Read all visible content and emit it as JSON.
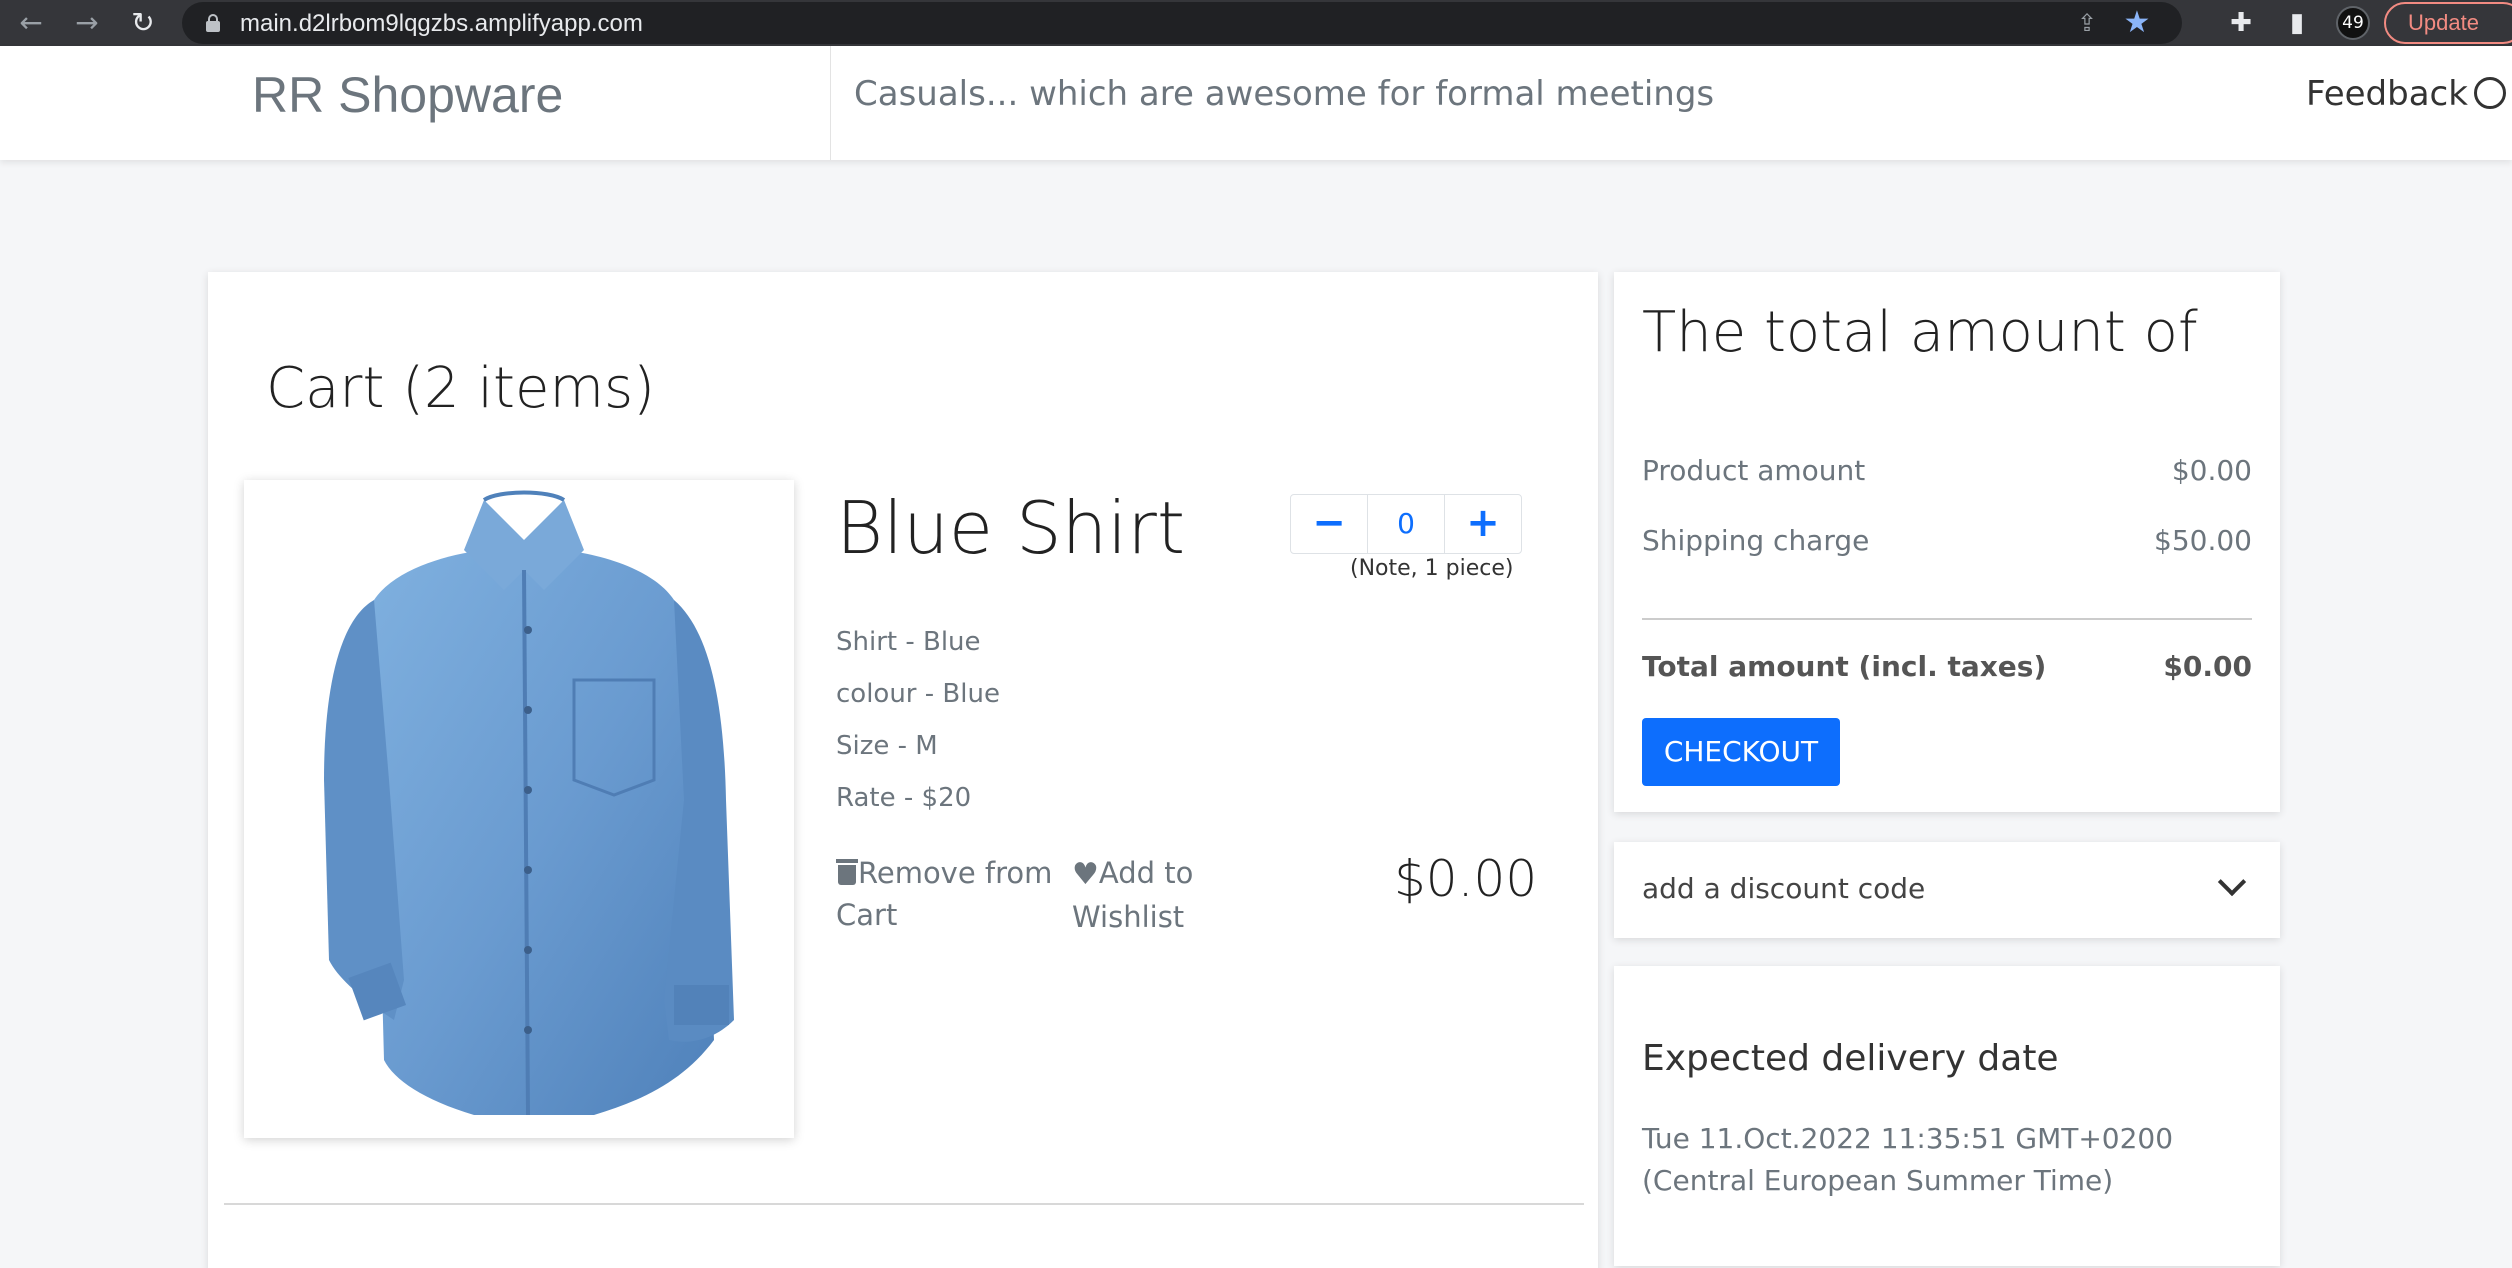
{
  "browser": {
    "url": "main.d2lrbom9lqgzbs.amplifyapp.com",
    "profile_badge": "49",
    "update_label": "Update"
  },
  "header": {
    "brand_bold": "RR",
    "brand_rest": "Shopware",
    "tagline": "Casuals... which are awesome for formal meetings",
    "feedback_label": "Feedback"
  },
  "cart": {
    "title": "Cart (2 items)",
    "item": {
      "name": "Blue Shirt",
      "specs": [
        "Shirt - Blue",
        "colour - Blue",
        "Size - M",
        "Rate - $20"
      ],
      "quantity": "0",
      "quantity_note": "(Note, 1 piece)",
      "remove_label": "Remove from Cart",
      "wishlist_label": "Add to Wishlist",
      "price": "$0.00",
      "shirt_color": "#6a9bd0"
    }
  },
  "summary": {
    "title": "The total amount of",
    "product_amount_label": "Product amount",
    "product_amount_value": "$0.00",
    "shipping_label": "Shipping charge",
    "shipping_value": "$50.00",
    "total_label": "Total amount (incl. taxes)",
    "total_value": "$0.00",
    "checkout_label": "CHECKOUT",
    "accent_color": "#0d6efd"
  },
  "discount": {
    "label": "add a discount code"
  },
  "delivery": {
    "title": "Expected delivery date",
    "date": "Tue 11.Oct.2022 11:35:51 GMT+0200 (Central European Summer Time)"
  }
}
